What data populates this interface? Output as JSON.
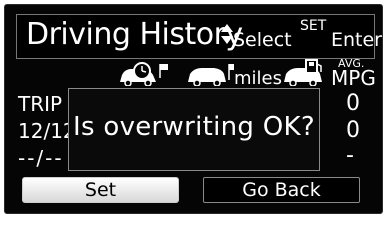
{
  "header": {
    "title": "Driving History",
    "select_label": "Select",
    "set_key": "SET",
    "enter_label": "Enter"
  },
  "columns": {
    "miles_label": "miles",
    "avg_label": "AVG.",
    "mpg_label": "MPG"
  },
  "rows": [
    {
      "label": "TRIP",
      "value": "0"
    },
    {
      "label": "12/12",
      "value": "0"
    },
    {
      "label": "--/--",
      "value": "-"
    }
  ],
  "dialog": {
    "message": "Is overwriting OK?"
  },
  "buttons": {
    "set_label": "Set",
    "back_label": "Go Back"
  },
  "colors": {
    "background": "#050505",
    "text": "#ffffff",
    "border": "#8a8a8a"
  }
}
